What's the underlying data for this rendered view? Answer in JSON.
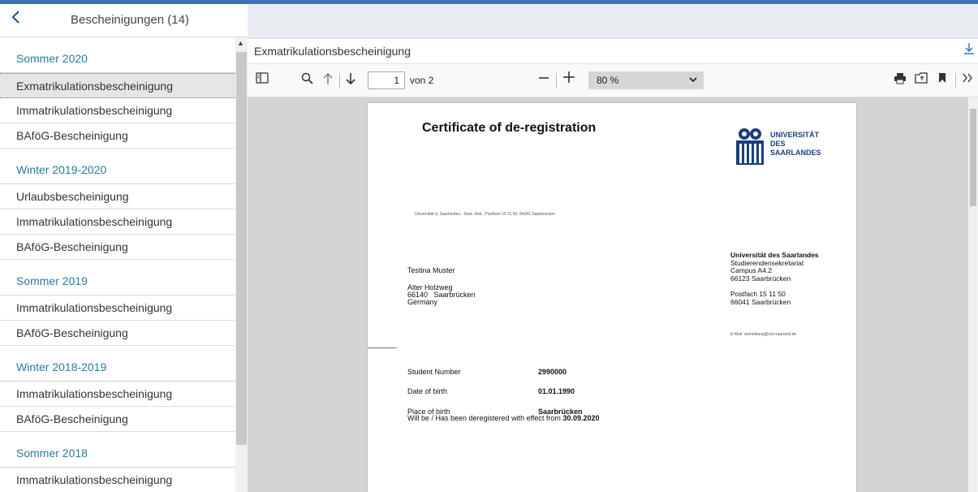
{
  "left_panel": {
    "title": "Bescheinigungen (14)",
    "back_icon": "chevron-left-icon",
    "sections": [
      {
        "title": "Sommer 2020",
        "items": [
          "Exmatrikulationsbescheinigung",
          "Immatrikulationsbescheinigung",
          "BAföG-Bescheinigung"
        ]
      },
      {
        "title": "Winter 2019-2020",
        "items": [
          "Urlaubsbescheinigung",
          "Immatrikulationsbescheinigung",
          "BAföG-Bescheinigung"
        ]
      },
      {
        "title": "Sommer 2019",
        "items": [
          "Immatrikulationsbescheinigung",
          "BAföG-Bescheinigung"
        ]
      },
      {
        "title": "Winter 2018-2019",
        "items": [
          "Immatrikulationsbescheinigung",
          "BAföG-Bescheinigung"
        ]
      },
      {
        "title": "Sommer 2018",
        "items": [
          "Immatrikulationsbescheinigung"
        ]
      }
    ],
    "selected": "Exmatrikulationsbescheinigung"
  },
  "document": {
    "title": "Exmatrikulationsbescheinigung",
    "download_icon": "download-icon"
  },
  "pdf_toolbar": {
    "page_current": "1",
    "page_of": "von 2",
    "zoom": "80 %",
    "minus": "—",
    "plus": "+"
  },
  "pdf_page": {
    "title": "Certificate of de-registration",
    "logo_line1": "UNIVERSITÄT",
    "logo_line2": "DES",
    "logo_line3": "SAARLANDES",
    "sender_line": "Universität d. Saarlandes - Stud.-Sek., Postfach 15 11 50, 66041 Saarbrücken",
    "recipient_name": "Testina Muster",
    "recipient_street": "Alter Holzweg",
    "recipient_city": "66140   Saarbrücken",
    "recipient_country": "Germany",
    "uni_name": "Universität des Saarlandes",
    "uni_dept": "Studierendensekretariat",
    "uni_campus": "Campus A4.2",
    "uni_city": "66123 Saarbrücken",
    "uni_postfach": "Postfach 15 11 50",
    "uni_postcity": "66041 Saarbrücken",
    "uni_email": "E-Mail: anmeldung@uni-saarland.de",
    "student_number_label": "Student Number",
    "student_number": "2990000",
    "dob_label": "Date of birth",
    "dob": "01.01.1990",
    "pob_label": "Place of birth",
    "pob": "Saarbrücken",
    "effect_text": "Will be / Has been deregistered with effect from",
    "effect_date": "30.09.2020"
  },
  "colors": {
    "top_bar": "#3d72b4",
    "section_title": "#2b7a9b",
    "logo": "#1b3f7a"
  }
}
